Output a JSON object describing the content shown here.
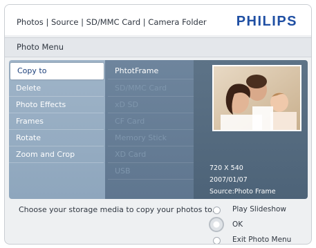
{
  "header": {
    "breadcrumb": "Photos | Source | SD/MMC Card | Camera Folder",
    "brand": "PHILIPS"
  },
  "menu_title": "Photo Menu",
  "photo_menu": {
    "items": [
      {
        "label": "Copy to",
        "selected": true
      },
      {
        "label": "Delete",
        "selected": false
      },
      {
        "label": "Photo Effects",
        "selected": false
      },
      {
        "label": "Frames",
        "selected": false
      },
      {
        "label": "Rotate",
        "selected": false
      },
      {
        "label": "Zoom and Crop",
        "selected": false
      }
    ]
  },
  "copy_targets": {
    "items": [
      {
        "label": "PhtotFrame",
        "enabled": true
      },
      {
        "label": "SD/MMC Card",
        "enabled": false
      },
      {
        "label": "xD SD",
        "enabled": false
      },
      {
        "label": "CF Card",
        "enabled": false
      },
      {
        "label": "Memory Stick",
        "enabled": false
      },
      {
        "label": "XD Card",
        "enabled": false
      },
      {
        "label": "USB",
        "enabled": false
      }
    ]
  },
  "preview": {
    "resolution": "720 X 540",
    "date": "2007/01/07",
    "source": "Source:Photo Frame"
  },
  "instruction": "Choose your storage media to copy your photos to.",
  "controls": {
    "play": "Play Slideshow",
    "ok": "OK",
    "exit": "Exit Photo Menu"
  },
  "colors": {
    "brand_blue": "#1f4fa3",
    "menu_column": "#9fb4c8",
    "submenu_column": "#6e859d",
    "preview_column": "#5d7387"
  }
}
